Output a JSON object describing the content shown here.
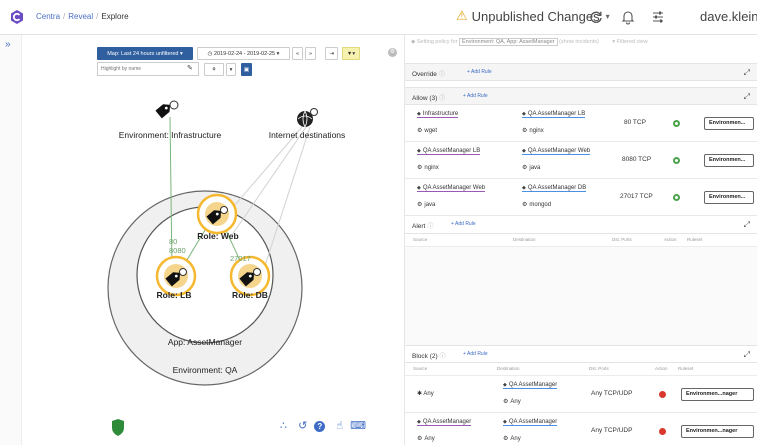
{
  "topbar": {
    "breadcrumb": [
      "Centra",
      "Reveal",
      "Explore"
    ],
    "unpublished": "Unpublished Changes",
    "user": "dave.klein"
  },
  "map_toolbar": {
    "map_select": "Map: Last 24 hours unfiltered",
    "date_range": "2019-02-24 - 2019-02-25",
    "highlight_placeholder": "Highlight by name"
  },
  "map": {
    "env_infra": "Environment: Infrastructure",
    "internet": "Internet destinations",
    "role_web": "Role: Web",
    "role_lb": "Role: LB",
    "role_db": "Role: DB",
    "app": "App: AssetManager",
    "env_qa": "Environment: QA",
    "ports": {
      "p80": "80",
      "p8080": "8080",
      "p27017": "27017"
    }
  },
  "policy": {
    "label": "Setting policy for",
    "scope": "Environment: QA, App: AssetManager",
    "suffix": "(show incidents)",
    "filtered": "Filtered view"
  },
  "override": {
    "title": "Override",
    "add": "+ Add Rule"
  },
  "allow": {
    "title": "Allow (3)",
    "add": "+ Add Rule",
    "rows": [
      {
        "src": "Infrastructure",
        "src_proc": "wget",
        "dst": "QA AssetManager LB",
        "dst_proc": "nginx",
        "port": "80 TCP",
        "ruleset": "Environmen..."
      },
      {
        "src": "QA AssetManager LB",
        "src_proc": "nginx",
        "dst": "QA AssetManager Web",
        "dst_proc": "java",
        "port": "8080 TCP",
        "ruleset": "Environmen..."
      },
      {
        "src": "QA AssetManager Web",
        "src_proc": "java",
        "dst": "QA AssetManager DB",
        "dst_proc": "mongod",
        "port": "27017 TCP",
        "ruleset": "Environmen..."
      }
    ]
  },
  "alert": {
    "title": "Alert",
    "add": "+ Add Rule",
    "columns": [
      "Source",
      "Destination",
      "Dst. Ports",
      "Action",
      "Ruleset"
    ]
  },
  "block": {
    "title": "Block (2)",
    "add": "+ Add Rule",
    "columns": [
      "Source",
      "Destination",
      "Dst. Ports",
      "Action",
      "Ruleset"
    ],
    "rows": [
      {
        "src": "Any",
        "src_proc": "",
        "dst": "QA AssetManager",
        "dst_proc": "Any",
        "port": "Any TCP/UDP",
        "ruleset": "Environmen...nager"
      },
      {
        "src": "QA AssetManager",
        "src_proc": "Any",
        "dst": "QA AssetManager",
        "dst_proc": "Any",
        "port": "Any TCP/UDP",
        "ruleset": "Environmen...nager"
      }
    ]
  },
  "colors": {
    "accent": "#2f5f9e",
    "role_ring": "#f5b82e",
    "allow_green": "#4aa24a",
    "block_red": "#d9382c"
  }
}
